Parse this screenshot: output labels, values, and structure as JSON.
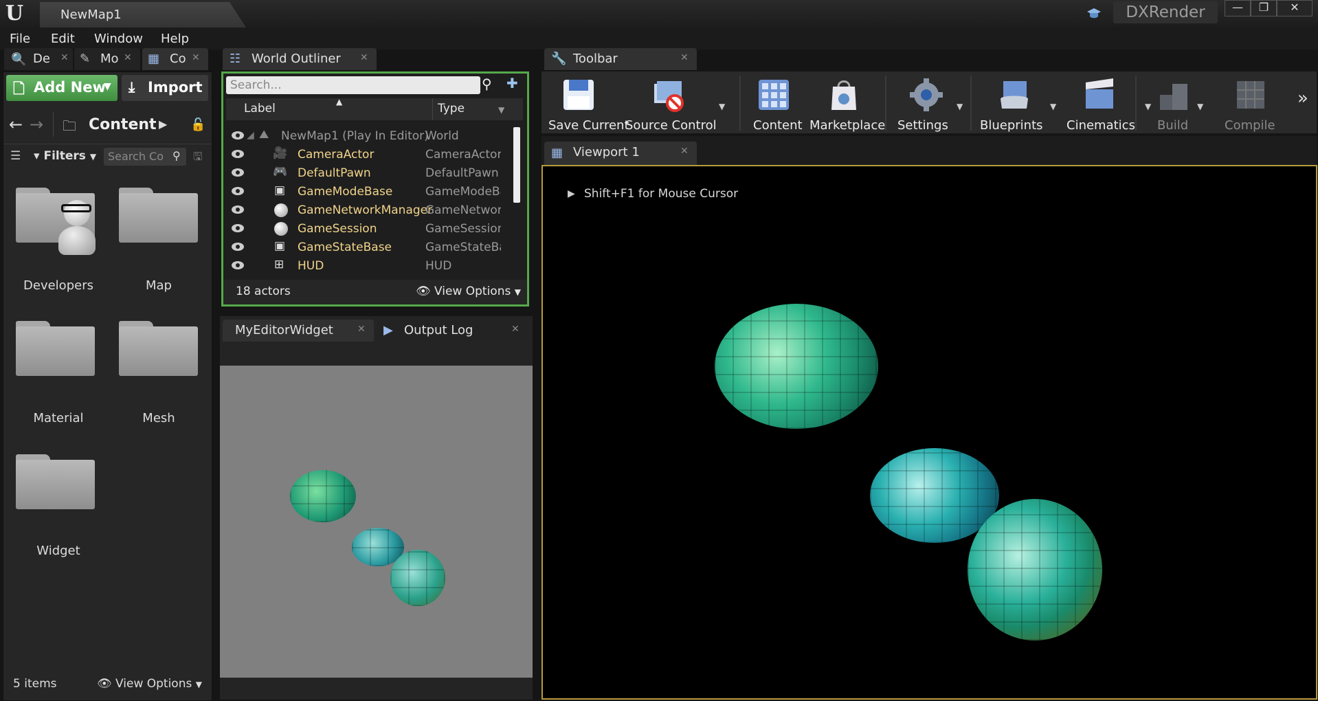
{
  "window": {
    "tab_title": "NewMap1",
    "render_label": "DXRender",
    "controls": [
      "—",
      "❐",
      "✕"
    ]
  },
  "menu": [
    "File",
    "Edit",
    "Window",
    "Help"
  ],
  "left_tabs": [
    "De",
    "Mo",
    "Co"
  ],
  "content_browser": {
    "add_new_label": "Add New",
    "import_label": "Import",
    "path_label": "Content",
    "filters_label": "Filters",
    "search_placeholder": "Search Co",
    "folders": [
      "Developers",
      "Map",
      "Material",
      "Mesh",
      "Widget"
    ],
    "item_count": "5 items",
    "view_options": "View Options"
  },
  "world_outliner": {
    "tab_label": "World Outliner",
    "search_placeholder": "Search...",
    "col_label": "Label",
    "col_type": "Type",
    "rows": [
      {
        "label": "NewMap1 (Play In Editor)",
        "type": "World"
      },
      {
        "label": "CameraActor",
        "type": "CameraActor"
      },
      {
        "label": "DefaultPawn",
        "type": "DefaultPawn"
      },
      {
        "label": "GameModeBase",
        "type": "GameModeBa"
      },
      {
        "label": "GameNetworkManager",
        "type": "GameNetwork"
      },
      {
        "label": "GameSession",
        "type": "GameSession"
      },
      {
        "label": "GameStateBase",
        "type": "GameStateBa"
      },
      {
        "label": "HUD",
        "type": "HUD"
      }
    ],
    "actor_count": "18 actors",
    "view_options": "View Options"
  },
  "bottom_tabs": [
    "MyEditorWidget",
    "Output Log"
  ],
  "toolbar": {
    "tab_label": "Toolbar",
    "buttons": [
      "Save Current",
      "Source Control",
      "Content",
      "Marketplace",
      "Settings",
      "Blueprints",
      "Cinematics",
      "Build",
      "Compile"
    ]
  },
  "viewport": {
    "tab_label": "Viewport 1",
    "hint": "Shift+F1 for Mouse Cursor"
  },
  "colors": {
    "accent_green": "#55a94a",
    "viewport_border": "#b79a3c",
    "actor_label": "#f1d48b"
  }
}
